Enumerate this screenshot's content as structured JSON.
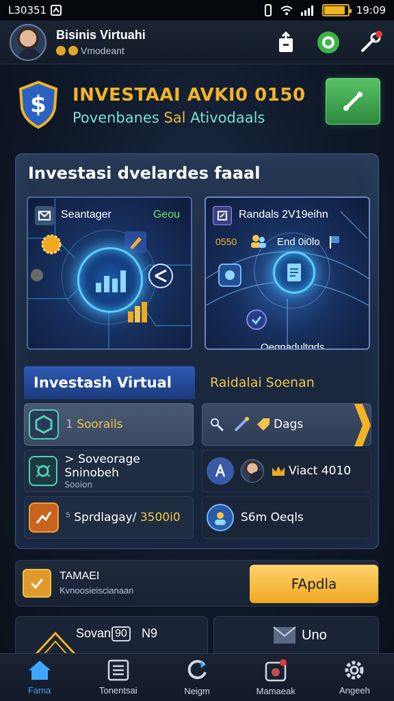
{
  "status": {
    "time_left": "L30351",
    "time_right": "19:09",
    "battery_level": 0.9
  },
  "header": {
    "user_name": "Bisinis Virtuahi",
    "user_sub": "Vmodeant"
  },
  "hero": {
    "title": "INVESTAAI AVKI0 0150",
    "subtitle_a": "Povenbanes ",
    "subtitle_b": "Sal",
    "subtitle_c": " Ativodaals",
    "icons": [
      "dollar-shield-icon",
      "expand-arrow-icon"
    ]
  },
  "panel": {
    "title": "Investasi dvelardes faaal",
    "card_left": {
      "label": "Seantager",
      "tag": "Geou"
    },
    "card_right": {
      "label": "Randals 2V19eihn",
      "num": "0550",
      "num_label": "End 0i0lo",
      "caption": "Oeqnadultqds"
    }
  },
  "sections": {
    "left_title": "Investash Virtual",
    "right_title": "Raidalai Soenan",
    "left_rows": [
      {
        "prefix": "1",
        "text": "Soorails",
        "sub": ""
      },
      {
        "prefix": ">",
        "text": "Soveorage Sninobeh",
        "sub": "Sooion"
      },
      {
        "prefix": "⁵",
        "text": "Sprdlagay/",
        "value": "3500i0"
      }
    ],
    "right_rows": [
      {
        "text": "Dags"
      },
      {
        "text": "Viact 4010"
      },
      {
        "text": "S6m Oeqls"
      }
    ]
  },
  "promo": {
    "title": "TAMAEI",
    "subtitle": "Kvnoosieiscianaan",
    "button": "FApdla"
  },
  "bottom_cards": {
    "left_text": "Sovan",
    "left_tag": "90",
    "left_num": "N9",
    "right_text": "Uno"
  },
  "nav": [
    {
      "label": "Fama",
      "icon": "home-icon"
    },
    {
      "label": "Tonentsai",
      "icon": "document-list-icon"
    },
    {
      "label": "Neigm",
      "icon": "refresh-icon"
    },
    {
      "label": "Mamaeak",
      "icon": "notification-icon"
    },
    {
      "label": "Angeeh",
      "icon": "gear-icon"
    }
  ],
  "colors": {
    "accent_gold": "#f2b426",
    "accent_blue": "#3da7ff",
    "accent_green": "#4cb65a",
    "accent_teal": "#7ee0d6"
  }
}
